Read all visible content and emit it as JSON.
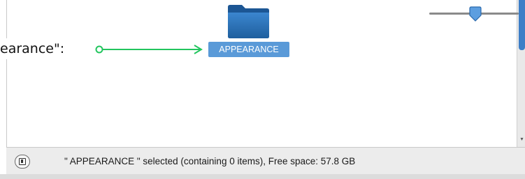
{
  "callout": {
    "text": "earance\":"
  },
  "file_view": {
    "selected_item": {
      "name": "APPEARANCE",
      "icon": "folder-icon",
      "icon_color": "#2e73b8",
      "label_bg": "#5a9ad8"
    }
  },
  "statusbar": {
    "preview_icon": "preview-panel-icon",
    "status_text": "\" APPEARANCE \" selected (containing 0 items), Free space: 57.8 GB",
    "zoom_level": 0.55
  },
  "colors": {
    "accent": "#3d7ec7",
    "arrow": "#22c55e"
  }
}
